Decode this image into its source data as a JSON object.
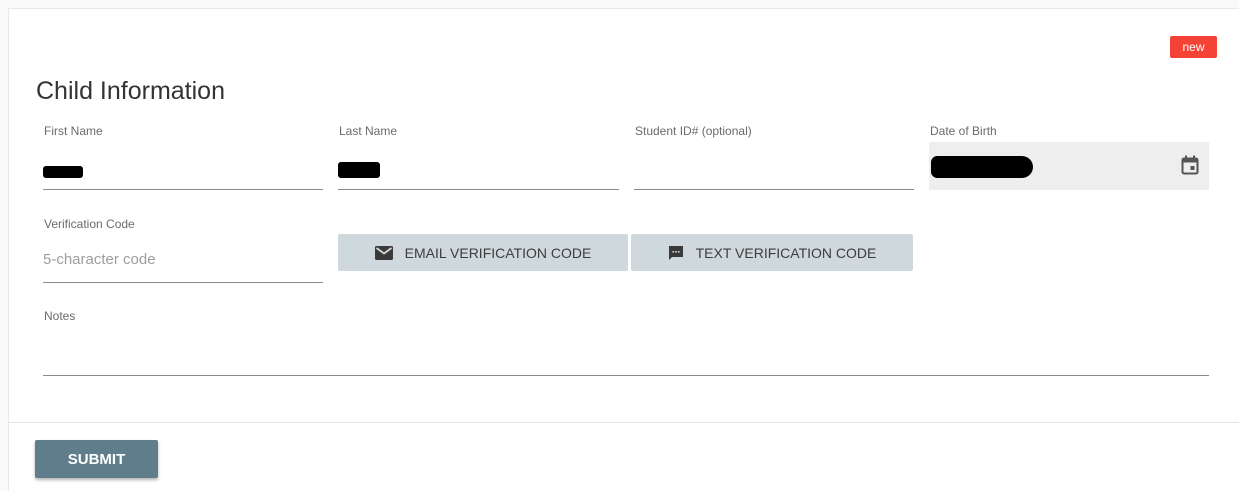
{
  "badge": "new",
  "section_title": "Child Information",
  "fields": {
    "first_name": {
      "label": "First Name"
    },
    "last_name": {
      "label": "Last Name"
    },
    "student_id": {
      "label": "Student ID# (optional)",
      "value": ""
    },
    "date_of_birth": {
      "label": "Date of Birth"
    },
    "verification_code": {
      "label": "Verification Code",
      "placeholder": "5-character code",
      "value": ""
    },
    "notes": {
      "label": "Notes",
      "value": ""
    }
  },
  "buttons": {
    "email_verification": "EMAIL VERIFICATION CODE",
    "text_verification": "TEXT VERIFICATION CODE",
    "submit": "SUBMIT"
  },
  "icons": {
    "email": "envelope-icon",
    "text": "message-icon",
    "calendar": "calendar-icon"
  },
  "colors": {
    "badge": "#f44336",
    "submit": "#607d8b",
    "secondary_button": "#cfd8dc"
  }
}
